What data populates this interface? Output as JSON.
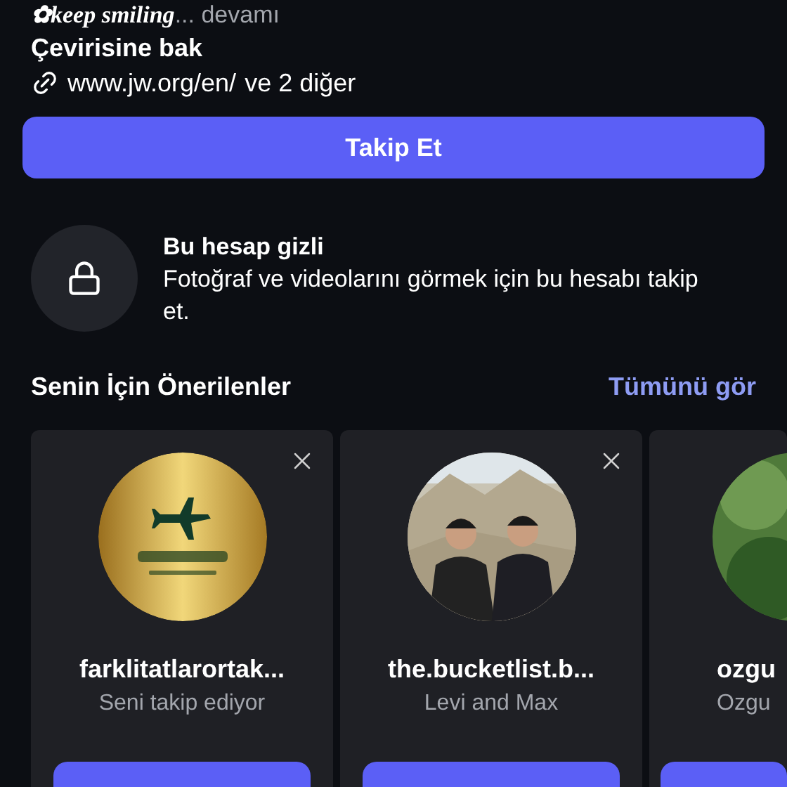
{
  "bio": {
    "text": "✿keep smiling",
    "more": "... devamı",
    "translate": "Çevirisine bak",
    "link": "www.jw.org/en/",
    "link_more": "ve 2 diğer"
  },
  "follow_button": "Takip Et",
  "private": {
    "title": "Bu hesap gizli",
    "text": "Fotoğraf ve videolarını görmek için bu hesabı takip et."
  },
  "suggestions": {
    "title": "Senin İçin Önerilenler",
    "see_all": "Tümünü gör",
    "cards": [
      {
        "username": "farklitatlarortak...",
        "subtitle": "Seni takip ediyor",
        "dismiss": true
      },
      {
        "username": "the.bucketlist.b...",
        "subtitle": "Levi and Max",
        "dismiss": true
      },
      {
        "username": "ozgu",
        "subtitle": "Ozgu",
        "dismiss": false
      }
    ]
  }
}
